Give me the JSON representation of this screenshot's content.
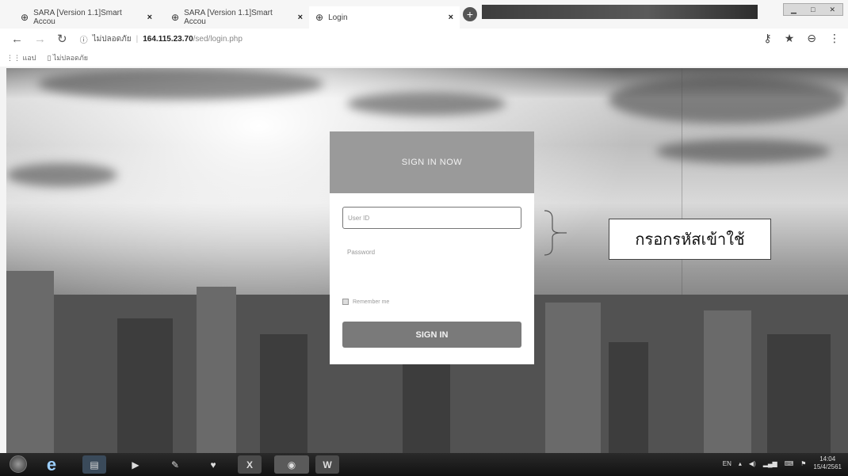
{
  "browser": {
    "tabs": [
      {
        "title": "SARA [Version 1.1]Smart Accou",
        "close": "×"
      },
      {
        "title": "SARA [Version 1.1]Smart Accou",
        "close": "×"
      },
      {
        "title": "Login",
        "close": "×"
      }
    ],
    "new_tab": "+",
    "address": {
      "security": "ไม่ปลอดภัย",
      "host": "164.115.23.70",
      "path": "/sed/login.php"
    },
    "bookmarks": [
      {
        "label": "แอป"
      },
      {
        "label": "ไม่ปลอดภัย"
      }
    ]
  },
  "login": {
    "header": "SIGN IN NOW",
    "userid_placeholder": "User ID",
    "password_placeholder": "Password",
    "remember_label": "Remember me",
    "signin_label": "SIGN IN"
  },
  "annotation": {
    "text": "กรอกรหัสเข้าใช้"
  },
  "taskbar": {
    "apps": [
      {
        "name": "ie-icon",
        "glyph": "e"
      },
      {
        "name": "explorer-icon",
        "glyph": "▤"
      },
      {
        "name": "media-icon",
        "glyph": "▶"
      },
      {
        "name": "tool-icon",
        "glyph": "✎"
      },
      {
        "name": "shield-app-icon",
        "glyph": "♥"
      },
      {
        "name": "excel-icon",
        "glyph": "X"
      },
      {
        "name": "chrome-icon",
        "glyph": "◉"
      },
      {
        "name": "word-icon",
        "glyph": "W"
      }
    ],
    "lang": "EN",
    "time": "14:04",
    "date": "15/4/2561"
  }
}
